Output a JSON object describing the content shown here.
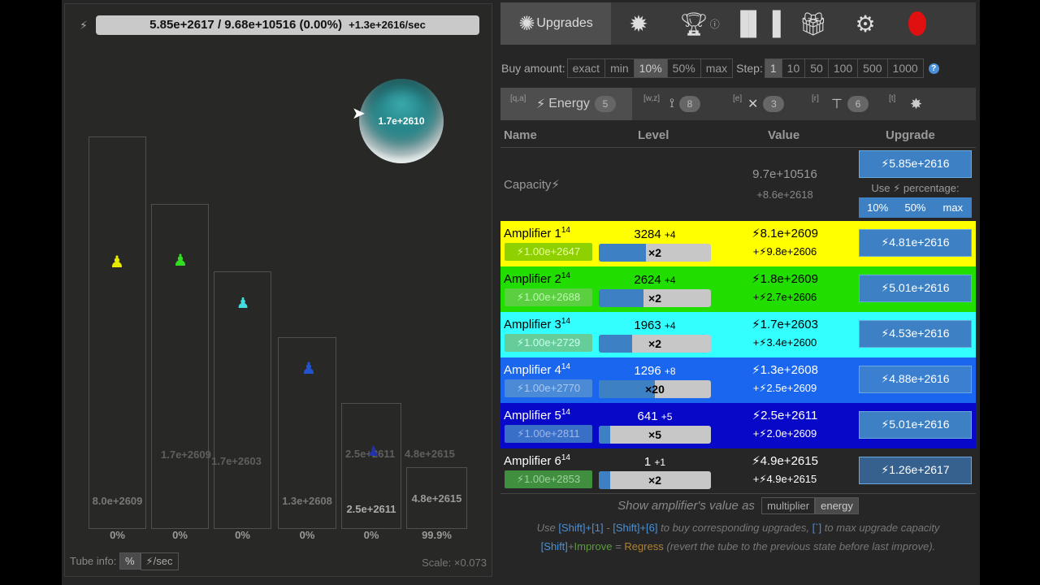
{
  "energy": {
    "current_of_max": "5.85e+2617 / 9.68e+10516 (0.00%)",
    "rate": "+1.3e+2616/sec"
  },
  "tubes": [
    {
      "value": "8.0e+2609",
      "pct": "0%",
      "ext": ""
    },
    {
      "value": "",
      "pct": "0%",
      "ext": "1.7e+2609"
    },
    {
      "value": "",
      "pct": "0%",
      "ext": "1.7e+2603"
    },
    {
      "value": "1.3e+2608",
      "pct": "0%",
      "ext": ""
    },
    {
      "value": "2.5e+2611",
      "pct": "0%",
      "ext": "2.5e+2611"
    },
    {
      "value": "4.8e+2615",
      "pct": "99.9%",
      "ext": "4.8e+2615"
    }
  ],
  "bubble": {
    "label": "1.7e+2610"
  },
  "tube_info": {
    "label": "Tube info:",
    "opt_pct": "%",
    "opt_sec": "/sec"
  },
  "scale": "Scale: ×0.073",
  "top_tabs": {
    "upgrades": "Upgrades"
  },
  "buy_amount": {
    "label": "Buy amount:",
    "options": [
      "exact",
      "min",
      "10%",
      "50%",
      "max"
    ],
    "selected": "10%"
  },
  "step": {
    "label": "Step:",
    "options": [
      "1",
      "10",
      "50",
      "100",
      "500",
      "1000"
    ],
    "selected": "1"
  },
  "sub_tabs": [
    {
      "key": "[q,a]",
      "label": "Energy",
      "count": "5"
    },
    {
      "key": "[w,z]",
      "label": "",
      "count": "8"
    },
    {
      "key": "[e]",
      "label": "",
      "count": "3"
    },
    {
      "key": "[r]",
      "label": "",
      "count": "6"
    },
    {
      "key": "[t]",
      "label": "",
      "count": ""
    }
  ],
  "table_head": {
    "name": "Name",
    "level": "Level",
    "value": "Value",
    "upgrade": "Upgrade"
  },
  "capacity": {
    "name": "Capacity",
    "value": "9.7e+10516",
    "delta": "+8.6e+2618",
    "button": "5.85e+2616",
    "use_label": "percentage:",
    "use_prefix": "Use",
    "pct_options": [
      "10%",
      "50%",
      "max"
    ]
  },
  "amplifiers": [
    {
      "name": "Amplifier 1",
      "sup": "14",
      "cost": "1.00e+2647",
      "level": "3284",
      "level_inc": "+4",
      "mult": "×2",
      "fill": 0.42,
      "value": "8.1e+2609",
      "value_inc": "9.8e+2606",
      "button": "4.81e+2616",
      "bg": "#ffff00",
      "fg": "#000",
      "cost_bg": "#8fd000",
      "cost_fg": "#e8ff9a",
      "btn": "#3d80c4"
    },
    {
      "name": "Amplifier 2",
      "sup": "14",
      "cost": "1.00e+2688",
      "level": "2624",
      "level_inc": "+4",
      "mult": "×2",
      "fill": 0.4,
      "value": "1.8e+2609",
      "value_inc": "2.7e+2606",
      "button": "5.01e+2616",
      "bg": "#22dd00",
      "fg": "#000",
      "cost_bg": "#5ad040",
      "cost_fg": "#bff5b0",
      "btn": "#3d80c4"
    },
    {
      "name": "Amplifier 3",
      "sup": "14",
      "cost": "1.00e+2729",
      "level": "1963",
      "level_inc": "+4",
      "mult": "×2",
      "fill": 0.3,
      "value": "1.7e+2603",
      "value_inc": "3.4e+2600",
      "button": "4.53e+2616",
      "bg": "#33ffff",
      "fg": "#000",
      "cost_bg": "#66cc99",
      "cost_fg": "#c8fff0",
      "btn": "#3d80c4"
    },
    {
      "name": "Amplifier 4",
      "sup": "14",
      "cost": "1.00e+2770",
      "level": "1296",
      "level_inc": "+8",
      "mult": "×20",
      "fill": 0.5,
      "value": "1.3e+2608",
      "value_inc": "2.5e+2609",
      "button": "4.88e+2616",
      "bg": "#1a66ee",
      "fg": "#fff",
      "cost_bg": "#4a8ad6",
      "cost_fg": "#a9c9f0",
      "btn": "#3a7fd0"
    },
    {
      "name": "Amplifier 5",
      "sup": "14",
      "cost": "1.00e+2811",
      "level": "641",
      "level_inc": "+5",
      "mult": "×5",
      "fill": 0.1,
      "value": "2.5e+2611",
      "value_inc": "2.0e+2609",
      "button": "5.01e+2616",
      "bg": "#0808c8",
      "fg": "#fff",
      "cost_bg": "#3a6fc8",
      "cost_fg": "#a0b8e8",
      "btn": "#3d80c4"
    },
    {
      "name": "Amplifier 6",
      "sup": "14",
      "cost": "1.00e+2853",
      "level": "1",
      "level_inc": "+1",
      "mult": "×2",
      "fill": 0.1,
      "value": "4.9e+2615",
      "value_inc": "4.9e+2615",
      "button": "1.26e+2617",
      "bg": "#262626",
      "fg": "#fff",
      "cost_bg": "#3f8f3f",
      "cost_fg": "#9fd09f",
      "btn": "#36618f"
    }
  ],
  "show_value": {
    "label": "Show amplifier's value as",
    "options": [
      "multiplier",
      "energy"
    ],
    "selected": "energy"
  },
  "hints": {
    "line1_a": "Use",
    "line1_k1": "[Shift]+[1]",
    "line1_dash": "-",
    "line1_k2": "[Shift]+[6]",
    "line1_b": "to buy corresponding upgrades,",
    "line1_k3": "[`]",
    "line1_c": "to max upgrade capacity",
    "line2_k": "[Shift]",
    "line2_plus": "+",
    "line2_improve": "Improve",
    "line2_eq": "=",
    "line2_regress": "Regress",
    "line2_tail": "(revert the tube to the previous state before last improve)."
  }
}
